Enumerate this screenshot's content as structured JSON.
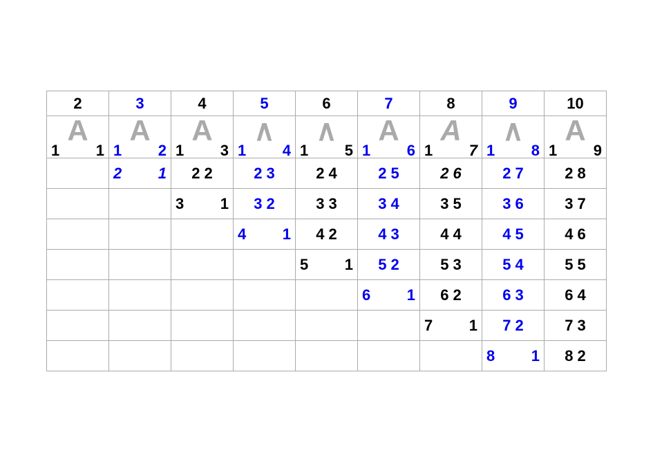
{
  "headers": [
    "2",
    "3",
    "4",
    "5",
    "6",
    "7",
    "8",
    "9",
    "10"
  ],
  "header_blue": [
    false,
    true,
    false,
    true,
    false,
    true,
    false,
    true,
    false
  ],
  "symbols": [
    "A",
    "A",
    "A",
    "∧",
    "∧",
    "A",
    "A",
    "∧",
    "A"
  ],
  "sym_pairs": [
    {
      "l": "1",
      "r": "1",
      "blue": false,
      "italic": false
    },
    {
      "l": "1",
      "r": "2",
      "blue": true,
      "italic": false
    },
    {
      "l": "1",
      "r": "3",
      "blue": false,
      "italic": false
    },
    {
      "l": "1",
      "r": "4",
      "blue": true,
      "italic": false
    },
    {
      "l": "1",
      "r": "5",
      "blue": false,
      "italic": false
    },
    {
      "l": "1",
      "r": "6",
      "blue": true,
      "italic": false
    },
    {
      "l": "1",
      "r": "7",
      "blue": false,
      "italic": true
    },
    {
      "l": "1",
      "r": "8",
      "blue": true,
      "italic": false
    },
    {
      "l": "1",
      "r": "9",
      "blue": false,
      "italic": false
    }
  ],
  "rows": [
    [
      null,
      {
        "l": "2",
        "r": "1",
        "blue": true,
        "italic": true
      },
      {
        "t": "2 2",
        "blue": false,
        "italic": false
      },
      {
        "t": "2 3",
        "blue": true,
        "italic": false
      },
      {
        "t": "2 4",
        "blue": false,
        "italic": false
      },
      {
        "t": "2 5",
        "blue": true,
        "italic": false
      },
      {
        "t": "2 6",
        "blue": false,
        "italic": true
      },
      {
        "t": "2 7",
        "blue": true,
        "italic": false
      },
      {
        "t": "2 8",
        "blue": false,
        "italic": false
      }
    ],
    [
      null,
      null,
      {
        "l": "3",
        "r": "1",
        "blue": false,
        "italic": false
      },
      {
        "t": "3 2",
        "blue": true,
        "italic": false
      },
      {
        "t": "3 3",
        "blue": false,
        "italic": false
      },
      {
        "t": "3 4",
        "blue": true,
        "italic": false
      },
      {
        "t": "3 5",
        "blue": false,
        "italic": false
      },
      {
        "t": "3 6",
        "blue": true,
        "italic": false
      },
      {
        "t": "3 7",
        "blue": false,
        "italic": false
      }
    ],
    [
      null,
      null,
      null,
      {
        "l": "4",
        "r": "1",
        "blue": true,
        "italic": false
      },
      {
        "t": "4 2",
        "blue": false,
        "italic": false
      },
      {
        "t": "4 3",
        "blue": true,
        "italic": false
      },
      {
        "t": "4 4",
        "blue": false,
        "italic": false
      },
      {
        "t": "4 5",
        "blue": true,
        "italic": false
      },
      {
        "t": "4 6",
        "blue": false,
        "italic": false
      }
    ],
    [
      null,
      null,
      null,
      null,
      {
        "l": "5",
        "r": "1",
        "blue": false,
        "italic": false
      },
      {
        "t": "5 2",
        "blue": true,
        "italic": false
      },
      {
        "t": "5 3",
        "blue": false,
        "italic": false
      },
      {
        "t": "5 4",
        "blue": true,
        "italic": false
      },
      {
        "t": "5 5",
        "blue": false,
        "italic": false
      }
    ],
    [
      null,
      null,
      null,
      null,
      null,
      {
        "l": "6",
        "r": "1",
        "blue": true,
        "italic": false
      },
      {
        "t": "6 2",
        "blue": false,
        "italic": false
      },
      {
        "t": "6 3",
        "blue": true,
        "italic": false
      },
      {
        "t": "6 4",
        "blue": false,
        "italic": false
      }
    ],
    [
      null,
      null,
      null,
      null,
      null,
      null,
      {
        "l": "7",
        "r": "1",
        "blue": false,
        "italic": false
      },
      {
        "t": "7 2",
        "blue": true,
        "italic": false
      },
      {
        "t": "7 3",
        "blue": false,
        "italic": false
      }
    ],
    [
      null,
      null,
      null,
      null,
      null,
      null,
      null,
      {
        "l": "8",
        "r": "1",
        "blue": true,
        "italic": false
      },
      {
        "t": "8 2",
        "blue": false,
        "italic": false
      }
    ]
  ]
}
